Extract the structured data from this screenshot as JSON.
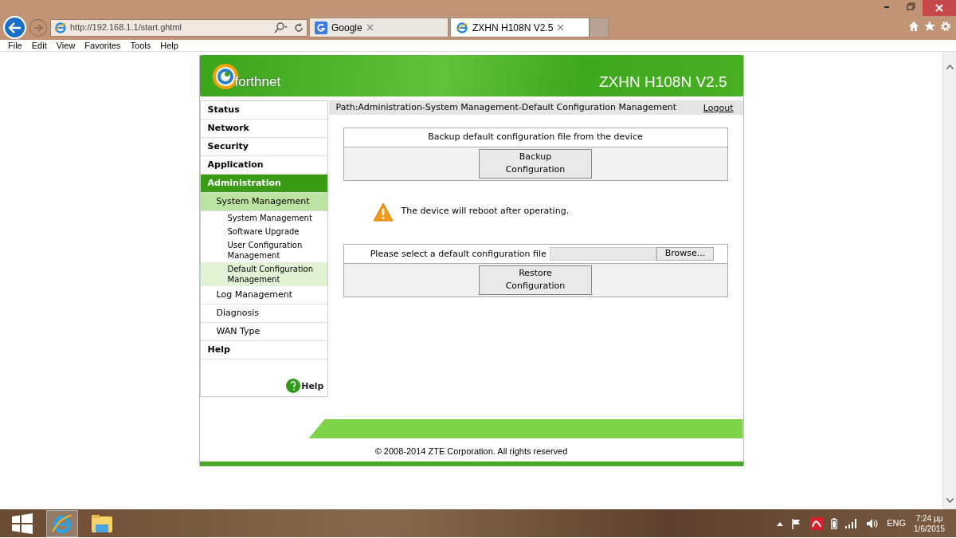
{
  "browser": {
    "address": "http://192.168.1.1/start.ghtml",
    "tabs": [
      {
        "title": "Google",
        "selected": false
      },
      {
        "title": "ZXHN H108N V2.5",
        "selected": true
      }
    ],
    "menu": [
      "File",
      "Edit",
      "View",
      "Favorites",
      "Tools",
      "Help"
    ]
  },
  "router": {
    "logo_text": "forthnet",
    "model": "ZXHN H108N V2.5",
    "nav": [
      {
        "label": "Status",
        "selected": false
      },
      {
        "label": "Network",
        "selected": false
      },
      {
        "label": "Security",
        "selected": false
      },
      {
        "label": "Application",
        "selected": false
      },
      {
        "label": "Administration",
        "selected": true,
        "children": [
          {
            "label": "System Management",
            "selected": true,
            "children": [
              {
                "label": "System Management",
                "selected": false
              },
              {
                "label": "Software Upgrade",
                "selected": false
              },
              {
                "label": "User Configuration Management",
                "selected": false
              },
              {
                "label": "Default Configuration Management",
                "selected": true
              }
            ]
          },
          {
            "label": "Log Management",
            "selected": false
          },
          {
            "label": "Diagnosis",
            "selected": false
          },
          {
            "label": "WAN Type",
            "selected": false
          }
        ]
      },
      {
        "label": "Help",
        "selected": false
      }
    ],
    "help_link": "Help",
    "path": "Path:Administration-System Management-Default Configuration Management",
    "logout": "Logout",
    "backup": {
      "title": "Backup default configuration file from the device",
      "button": "Backup Configuration"
    },
    "warning": "The device will reboot after operating.",
    "restore": {
      "label": "Please select a default configuration file",
      "browse": "Browse...",
      "button": "Restore Configuration"
    },
    "copyright": "© 2008-2014 ZTE Corporation. All rights reserved"
  },
  "taskbar": {
    "language": "ENG",
    "time": "7:24 μμ",
    "date": "1/6/2015"
  }
}
